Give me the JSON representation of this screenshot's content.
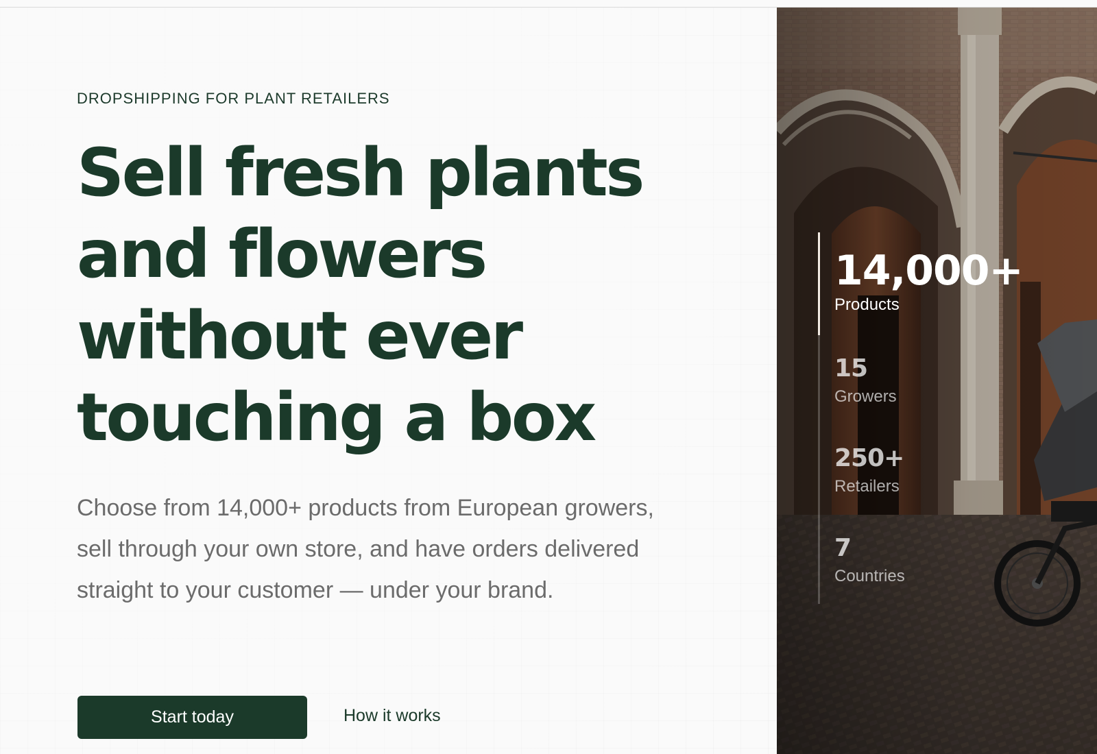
{
  "hero": {
    "eyebrow": "DROPSHIPPING FOR PLANT RETAILERS",
    "headline_lines": [
      "Sell fresh plants",
      "and flowers",
      "without ever",
      "touching a box"
    ],
    "subtext": "Choose from 14,000+ products from European growers, sell through your own store, and have orders delivered straight to your customer — under your brand.",
    "primary_cta": "Start today",
    "secondary_cta": "How it works"
  },
  "stats": [
    {
      "value": "14,000+",
      "label": "Products",
      "active": true
    },
    {
      "value": "15",
      "label": "Growers",
      "active": false
    },
    {
      "value": "250+",
      "label": "Retailers",
      "active": false
    },
    {
      "value": "7",
      "label": "Countries",
      "active": false
    }
  ],
  "colors": {
    "brand_dark_green": "#1b3a2a",
    "page_background": "#fafafa",
    "body_text_gray": "#6b6b6b",
    "stat_rail_active": "#f3ebe3"
  }
}
